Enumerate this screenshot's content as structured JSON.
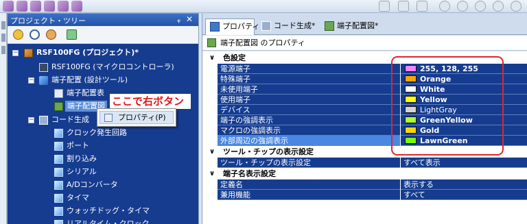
{
  "project_tree": {
    "title": "プロジェクト・ツリー",
    "pin_glyph": "ᵩ",
    "close_glyph": "✕",
    "nodes": [
      {
        "label": "RSF100FG (プロジェクト)*"
      },
      {
        "label": "RSF100FG (マイクロコントローラ)"
      },
      {
        "label": "端子配置 (設計ツール)"
      },
      {
        "label": "端子配置表"
      },
      {
        "label": "端子配置図"
      },
      {
        "label": "コード生成"
      },
      {
        "label": "クロック発生回路"
      },
      {
        "label": "ポート"
      },
      {
        "label": "割り込み"
      },
      {
        "label": "シリアル"
      },
      {
        "label": "A/Dコンバータ"
      },
      {
        "label": "タイマ"
      },
      {
        "label": "ウォッチドッグ・タイマ"
      },
      {
        "label": "リアルタイム・クロック"
      }
    ]
  },
  "context_menu": {
    "item": "プロパティ(P)"
  },
  "annotation": "ここで右ボタン",
  "tabs": [
    {
      "label": "プロパティ"
    },
    {
      "label": "コード生成*"
    },
    {
      "label": "端子配置図*"
    }
  ],
  "properties": {
    "title": "端子配置図 のプロパティ",
    "categories": [
      {
        "name": "色設定",
        "rows": [
          {
            "name": "電源端子",
            "value": "255, 128, 255",
            "color": "#ff80ff"
          },
          {
            "name": "特殊端子",
            "value": "Orange",
            "color": "#ffa500"
          },
          {
            "name": "未使用端子",
            "value": "White",
            "color": "#ffffff"
          },
          {
            "name": "使用端子",
            "value": "Yellow",
            "color": "#ffff00"
          },
          {
            "name": "デバイス",
            "value": "LightGray",
            "color": "#d3d3d3"
          },
          {
            "name": "端子の強調表示",
            "value": "GreenYellow",
            "color": "#adff2f"
          },
          {
            "name": "マクロの強調表示",
            "value": "Gold",
            "color": "#ffd700"
          },
          {
            "name": "外部周辺の強調表示",
            "value": "LawnGreen",
            "color": "#7cfc00"
          }
        ]
      },
      {
        "name": "ツール・チップの表示設定",
        "rows": [
          {
            "name": "ツール・チップの表示設定",
            "value": "すべて表示"
          }
        ]
      },
      {
        "name": "端子名表示設定",
        "rows": [
          {
            "name": "定義名",
            "value": "表示する"
          },
          {
            "name": "兼用機能",
            "value": "すべて"
          }
        ]
      }
    ]
  },
  "colors": {
    "selection_blue": "#163c8f",
    "highlight_blue": "#4a87e0",
    "annotation_red": "#e0141b"
  }
}
